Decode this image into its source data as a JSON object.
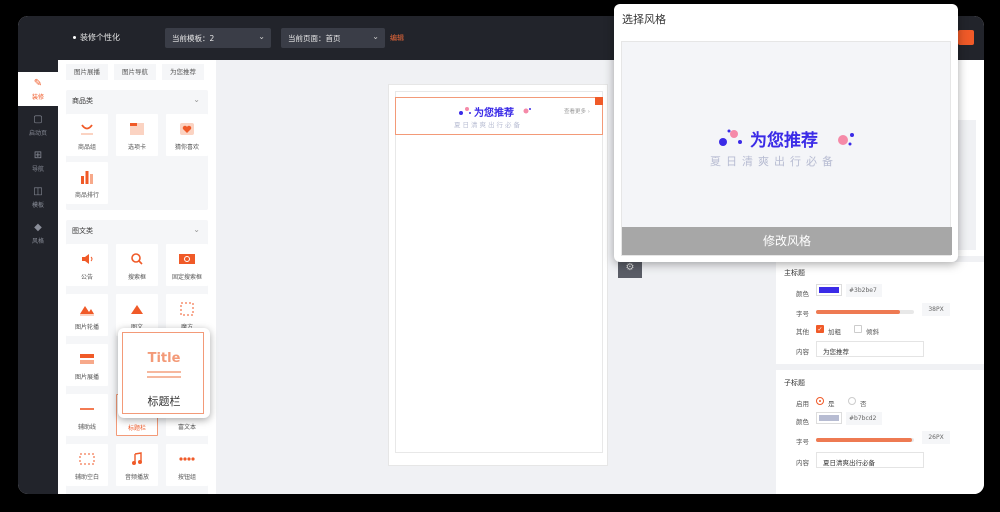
{
  "topbar": {
    "brand": "装修个性化",
    "template_select": "当前模板：2",
    "page_select": "当前页面：首页",
    "edit_link": "编辑"
  },
  "leftnav": {
    "items": [
      {
        "label": "装修",
        "icon": "brush-icon"
      },
      {
        "label": "启动页",
        "icon": "launch-icon"
      },
      {
        "label": "导航",
        "icon": "grid-icon"
      },
      {
        "label": "模板",
        "icon": "template-icon"
      },
      {
        "label": "风格",
        "icon": "palette-icon"
      }
    ]
  },
  "components": {
    "top_row": [
      "图片展播",
      "图片导航",
      "为您推荐"
    ],
    "sections": [
      {
        "title": "商品类",
        "items": [
          "商品组",
          "选项卡",
          "猜你喜欢",
          "商品排行"
        ]
      },
      {
        "title": "图文类",
        "items": [
          "公告",
          "搜索框",
          "固定搜索框",
          "图片轮播",
          "图文",
          "魔方",
          "图片展播",
          "",
          "",
          "辅助线",
          "标题栏",
          "富文本",
          "辅助空白",
          "音频播放",
          "按钮组"
        ]
      }
    ]
  },
  "canvas": {
    "title": "为您推荐",
    "subtitle": "夏日清爽出行必备",
    "more": "查看更多"
  },
  "style_popup": {
    "title": "选择风格",
    "preview_title": "为您推荐",
    "preview_subtitle": "夏日清爽出行必备",
    "button": "修改风格"
  },
  "drag_preview": {
    "title": "Title",
    "label": "标题栏"
  },
  "settings": {
    "main_title": {
      "heading": "主标题",
      "color_label": "颜色",
      "color": "#3b2be7",
      "size_label": "字号",
      "size_value": "38PX",
      "size_fraction": 0.86,
      "other_label": "其他",
      "bold_label": "加粗",
      "bold_checked": true,
      "italic_label": "倾斜",
      "content_label": "内容",
      "content_value": "为您推荐"
    },
    "sub_title": {
      "heading": "子标题",
      "enable_label": "启用",
      "yes_label": "是",
      "no_label": "否",
      "color_label": "颜色",
      "color": "#b7bcd2",
      "size_label": "字号",
      "size_value": "26PX",
      "size_fraction": 0.98,
      "content_label": "内容",
      "content_value": "夏日清爽出行必备"
    }
  },
  "colors": {
    "accent": "#f05a28",
    "title_blue": "#3b2be7",
    "sub_gray": "#b7bcd2"
  }
}
